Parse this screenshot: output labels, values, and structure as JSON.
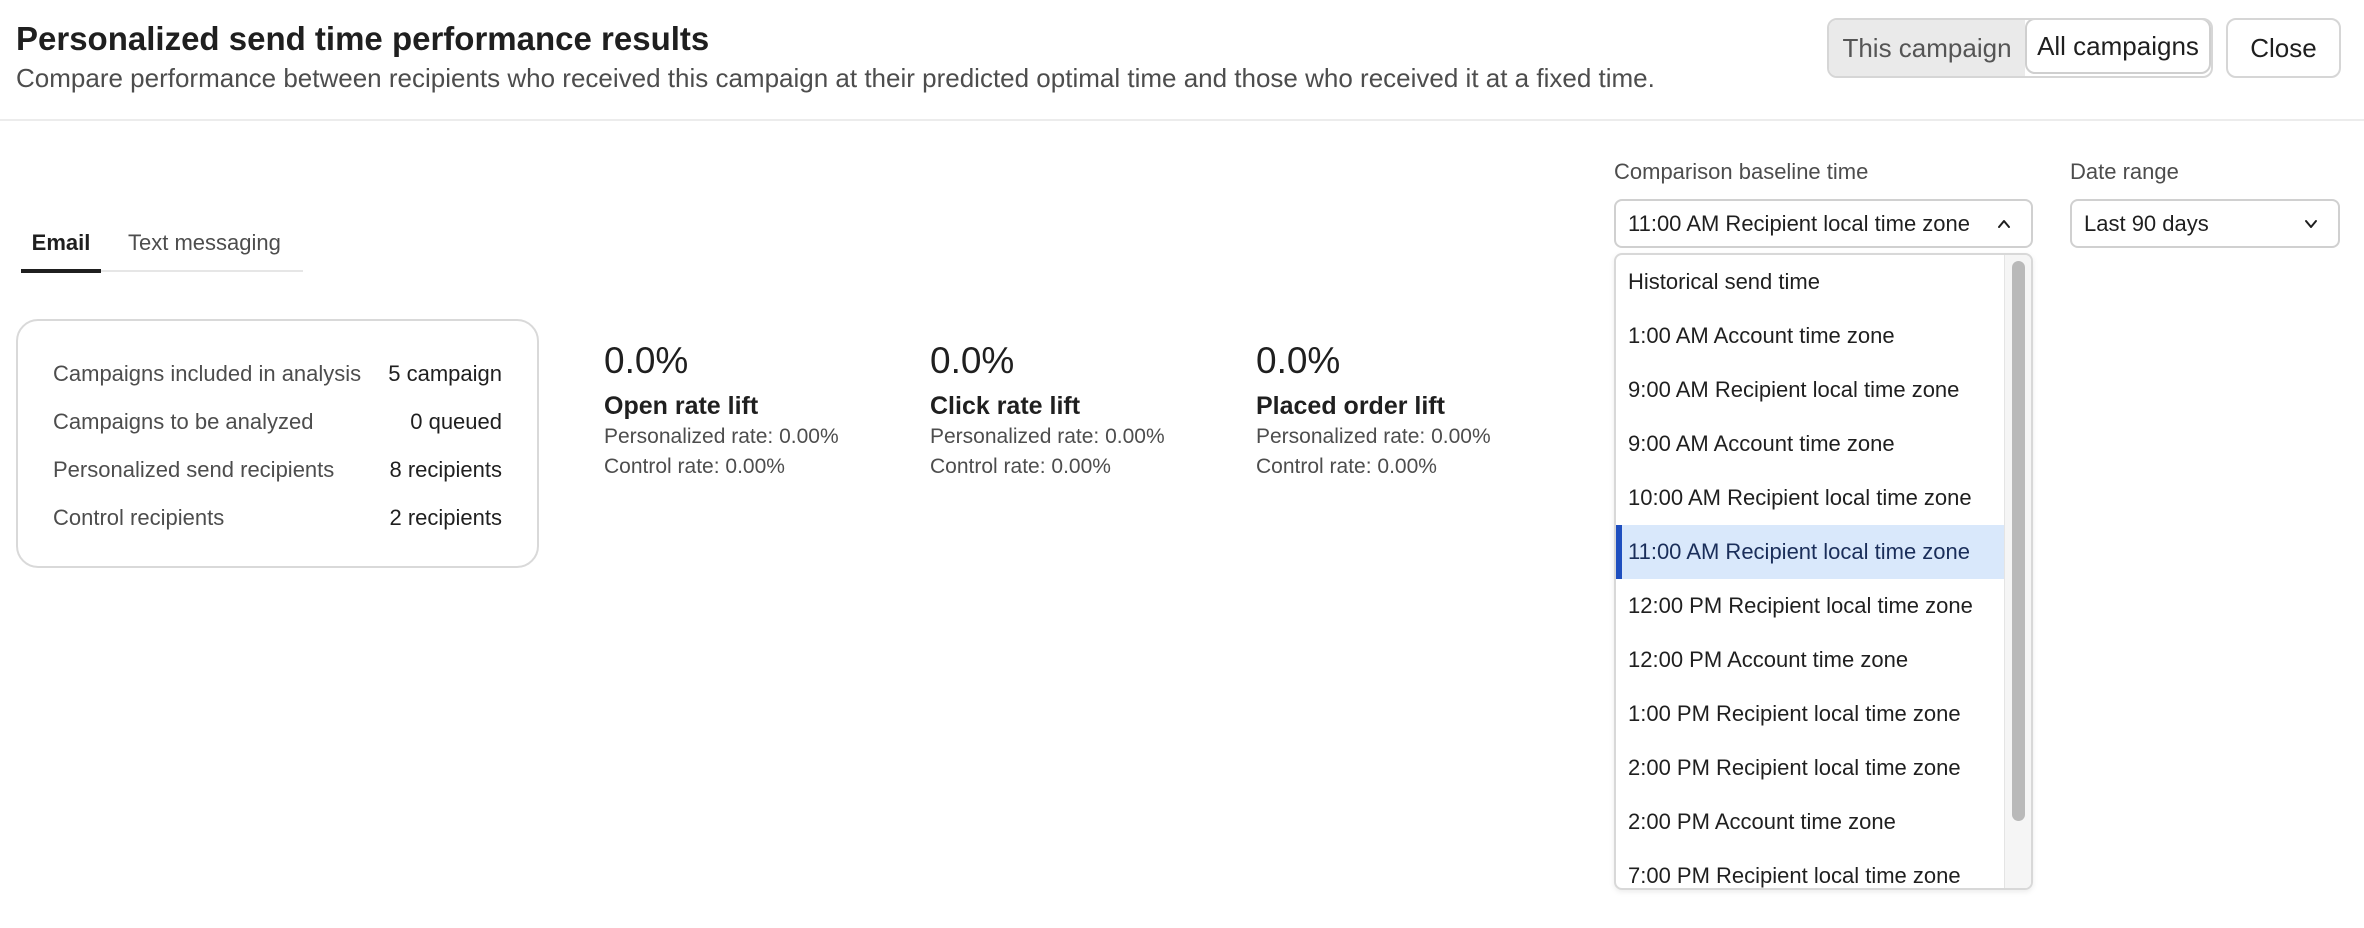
{
  "header": {
    "title": "Personalized send time performance results",
    "subtitle": "Compare performance between recipients who received this campaign at their predicted optimal time and those who received it at a fixed time.",
    "scope_toggle": {
      "options": [
        "This campaign",
        "All campaigns"
      ],
      "selected": "All campaigns"
    },
    "close_label": "Close"
  },
  "tabs": [
    {
      "label": "Email",
      "active": true
    },
    {
      "label": "Text messaging",
      "active": false
    }
  ],
  "summary": [
    {
      "label": "Campaigns included in analysis",
      "value": "5 campaign"
    },
    {
      "label": "Campaigns to be analyzed",
      "value": "0 queued"
    },
    {
      "label": "Personalized send recipients",
      "value": "8 recipients"
    },
    {
      "label": "Control recipients",
      "value": "2 recipients"
    }
  ],
  "metrics": [
    {
      "value": "0.0%",
      "name": "Open rate lift",
      "personalized": "Personalized rate: 0.00%",
      "control": "Control rate: 0.00%"
    },
    {
      "value": "0.0%",
      "name": "Click rate lift",
      "personalized": "Personalized rate: 0.00%",
      "control": "Control rate: 0.00%"
    },
    {
      "value": "0.0%",
      "name": "Placed order lift",
      "personalized": "Personalized rate: 0.00%",
      "control": "Control rate: 0.00%"
    }
  ],
  "filters": {
    "baseline": {
      "label": "Comparison baseline time",
      "value": "11:00 AM Recipient local time zone",
      "expanded": true
    },
    "date_range": {
      "label": "Date range",
      "value": "Last 90 days"
    }
  },
  "baseline_options": [
    "Historical send time",
    "1:00 AM Account time zone",
    "9:00 AM Recipient local time zone",
    "9:00 AM Account time zone",
    "10:00 AM Recipient local time zone",
    "11:00 AM Recipient local time zone",
    "12:00 PM Recipient local time zone",
    "12:00 PM Account time zone",
    "1:00 PM Recipient local time zone",
    "2:00 PM Recipient local time zone",
    "2:00 PM Account time zone",
    "7:00 PM Recipient local time zone"
  ],
  "selected_option": "11:00 AM Recipient local time zone",
  "colors": {
    "selected_bg": "#d9e8fb",
    "selected_accent": "#1f4fbf",
    "border": "#d9d9d9"
  },
  "icons": {
    "baseline_select": "chevron-up-icon",
    "date_select": "chevron-down-icon"
  }
}
